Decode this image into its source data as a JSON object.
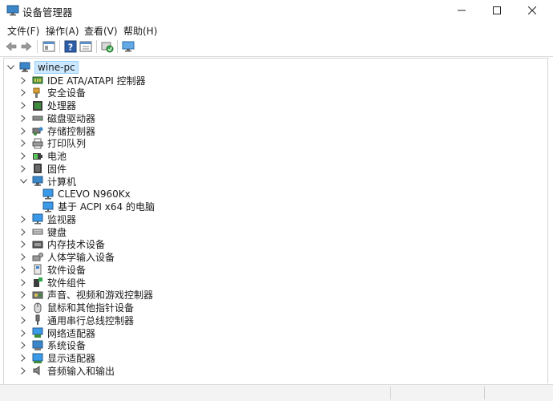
{
  "window": {
    "title": "设备管理器"
  },
  "menu": [
    "文件(F)",
    "操作(A)",
    "查看(V)",
    "帮助(H)"
  ],
  "tree": {
    "root": "wine-pc",
    "nodes": [
      {
        "label": "IDE ATA/ATAPI 控制器",
        "icon": "ide-controller-icon",
        "expanded": false
      },
      {
        "label": "安全设备",
        "icon": "security-key-icon",
        "expanded": false
      },
      {
        "label": "处理器",
        "icon": "processor-icon",
        "expanded": false
      },
      {
        "label": "磁盘驱动器",
        "icon": "disk-drive-icon",
        "expanded": false
      },
      {
        "label": "存储控制器",
        "icon": "storage-controller-icon",
        "expanded": false
      },
      {
        "label": "打印队列",
        "icon": "printer-icon",
        "expanded": false
      },
      {
        "label": "电池",
        "icon": "battery-icon",
        "expanded": false
      },
      {
        "label": "固件",
        "icon": "firmware-icon",
        "expanded": false
      },
      {
        "label": "计算机",
        "icon": "computer-icon",
        "expanded": true
      },
      {
        "label": "CLEVO N960Kx",
        "icon": "monitor-icon",
        "child": true
      },
      {
        "label": "基于 ACPI x64 的电脑",
        "icon": "monitor-icon",
        "child": true
      },
      {
        "label": "监视器",
        "icon": "monitor-icon",
        "expanded": false
      },
      {
        "label": "键盘",
        "icon": "keyboard-icon",
        "expanded": false
      },
      {
        "label": "内存技术设备",
        "icon": "memory-device-icon",
        "expanded": false
      },
      {
        "label": "人体学输入设备",
        "icon": "hid-icon",
        "expanded": false
      },
      {
        "label": "软件设备",
        "icon": "software-device-icon",
        "expanded": false
      },
      {
        "label": "软件组件",
        "icon": "software-component-icon",
        "expanded": false
      },
      {
        "label": "声音、视频和游戏控制器",
        "icon": "sound-icon",
        "expanded": false
      },
      {
        "label": "鼠标和其他指针设备",
        "icon": "mouse-icon",
        "expanded": false
      },
      {
        "label": "通用串行总线控制器",
        "icon": "usb-icon",
        "expanded": false
      },
      {
        "label": "网络适配器",
        "icon": "network-adapter-icon",
        "expanded": false
      },
      {
        "label": "系统设备",
        "icon": "system-device-icon",
        "expanded": false
      },
      {
        "label": "显示适配器",
        "icon": "display-adapter-icon",
        "expanded": false
      },
      {
        "label": "音频输入和输出",
        "icon": "audio-io-icon",
        "expanded": false
      }
    ]
  }
}
